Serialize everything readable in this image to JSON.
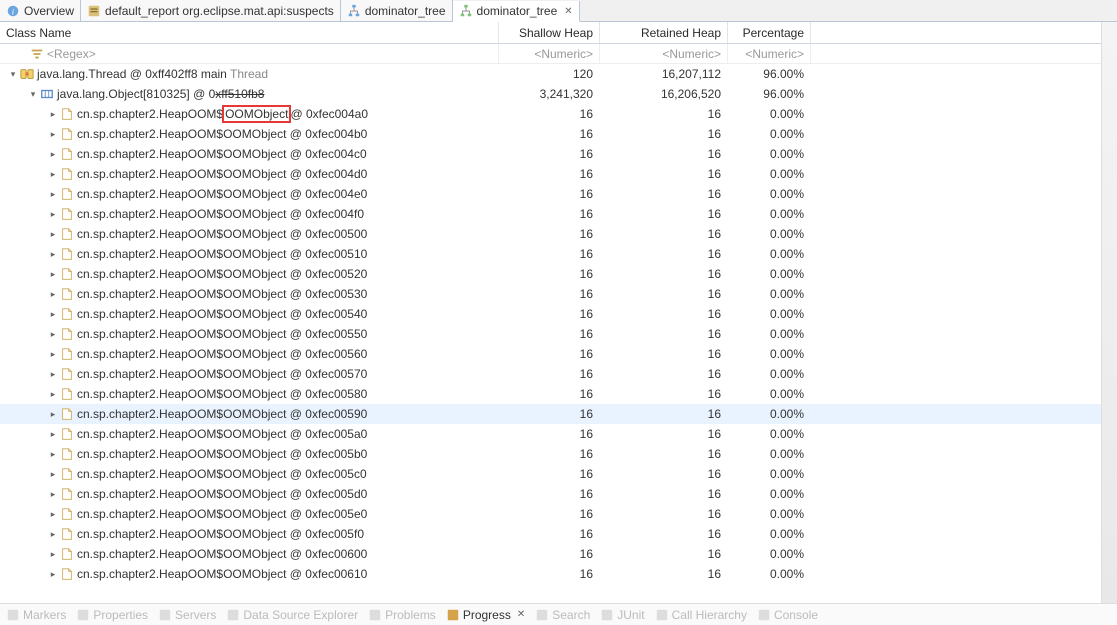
{
  "tabs": [
    {
      "icon": "info",
      "label": "Overview"
    },
    {
      "icon": "report",
      "label": "default_report  org.eclipse.mat.api:suspects"
    },
    {
      "icon": "tree-blue",
      "label": "dominator_tree"
    },
    {
      "icon": "tree-green",
      "label": "dominator_tree",
      "active": true,
      "closable": true
    }
  ],
  "headers": {
    "class": "Class Name",
    "shallow": "Shallow Heap",
    "retained": "Retained Heap",
    "percent": "Percentage"
  },
  "filter": {
    "regex": "<Regex>",
    "numeric": "<Numeric>"
  },
  "tree": {
    "root": {
      "icon": "thread",
      "label_prefix": "java.lang.Thread @ 0xff402ff8  main ",
      "label_gray": "Thread",
      "shallow": "120",
      "retained": "16,207,112",
      "percent": "96.00%",
      "expanded": true
    },
    "child": {
      "icon": "array",
      "label_prefix": "java.lang.Object[810325] @ 0",
      "label_strike": "xff510fb8",
      "shallow": "3,241,320",
      "retained": "16,206,520",
      "percent": "96.00%",
      "expanded": true
    },
    "grandchild_first": {
      "icon": "class",
      "label_before_box": "cn.sp.chapter2.HeapOOM$",
      "label_boxed": "OOMObject ",
      "label_after_box": "@ 0xfec004a0",
      "shallow": "16",
      "retained": "16",
      "percent": "0.00%"
    },
    "leaf_template": {
      "icon": "class",
      "label_prefix": "cn.sp.chapter2.HeapOOM$OOMObject @ ",
      "shallow": "16",
      "retained": "16",
      "percent": "0.00%"
    },
    "leaf_addresses": [
      "0xfec004b0",
      "0xfec004c0",
      "0xfec004d0",
      "0xfec004e0",
      "0xfec004f0",
      "0xfec00500",
      "0xfec00510",
      "0xfec00520",
      "0xfec00530",
      "0xfec00540",
      "0xfec00550",
      "0xfec00560",
      "0xfec00570",
      "0xfec00580",
      "0xfec00590",
      "0xfec005a0",
      "0xfec005b0",
      "0xfec005c0",
      "0xfec005d0",
      "0xfec005e0",
      "0xfec005f0",
      "0xfec00600",
      "0xfec00610"
    ],
    "highlighted_addr": "0xfec00590"
  },
  "bottom_items": [
    "Markers",
    "Properties",
    "Servers",
    "Data Source Explorer",
    "Problems",
    "Progress",
    "Search",
    "JUnit",
    "Call Hierarchy",
    "Console"
  ],
  "bottom_active": "Progress"
}
